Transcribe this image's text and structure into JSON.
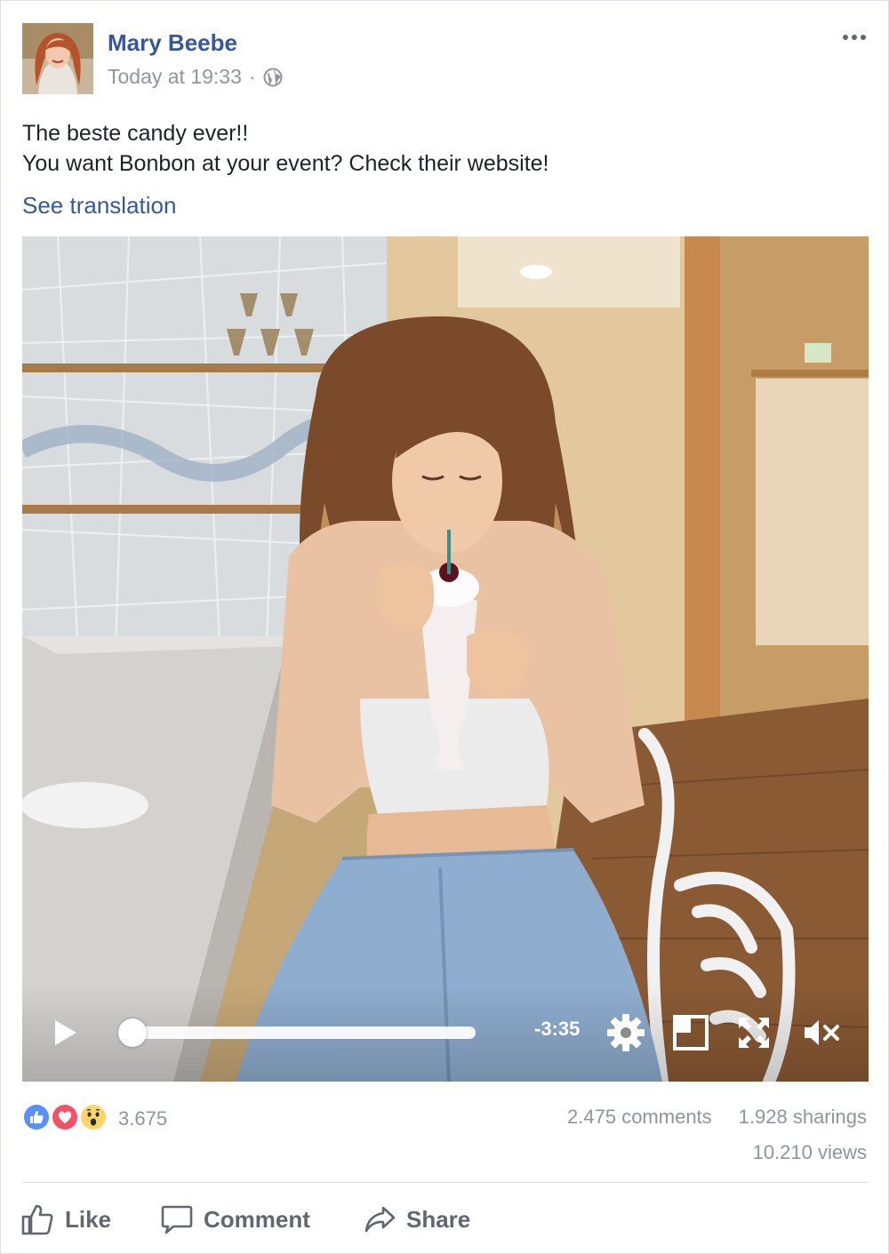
{
  "post": {
    "author": "Mary Beebe",
    "timestamp": "Today at 19:33",
    "separator": "·",
    "privacy_icon": "globe-icon",
    "more_icon": "more-options-icon",
    "text_lines": [
      "The beste candy ever!!",
      "You want Bonbon at your event? Check their website!"
    ],
    "translate_link": "See translation"
  },
  "video": {
    "remaining_time": "-3:35",
    "progress": 0,
    "controls": [
      "play-icon",
      "gear-icon",
      "miniplayer-icon",
      "fullscreen-icon",
      "muted-icon"
    ]
  },
  "engagement": {
    "reaction_icons": [
      "like-reaction-icon",
      "love-reaction-icon",
      "wow-reaction-icon"
    ],
    "reaction_count": "3.675",
    "comments": "2.475 comments",
    "sharings": "1.928 sharings",
    "views": "10.210 views"
  },
  "actions": {
    "like": "Like",
    "comment": "Comment",
    "share": "Share"
  },
  "colors": {
    "link": "#365899",
    "muted_text": "#90949c",
    "action_text": "#606770",
    "like_blue": "#5890ff",
    "love_red": "#f25268",
    "wow_yellow": "#fcd669"
  }
}
